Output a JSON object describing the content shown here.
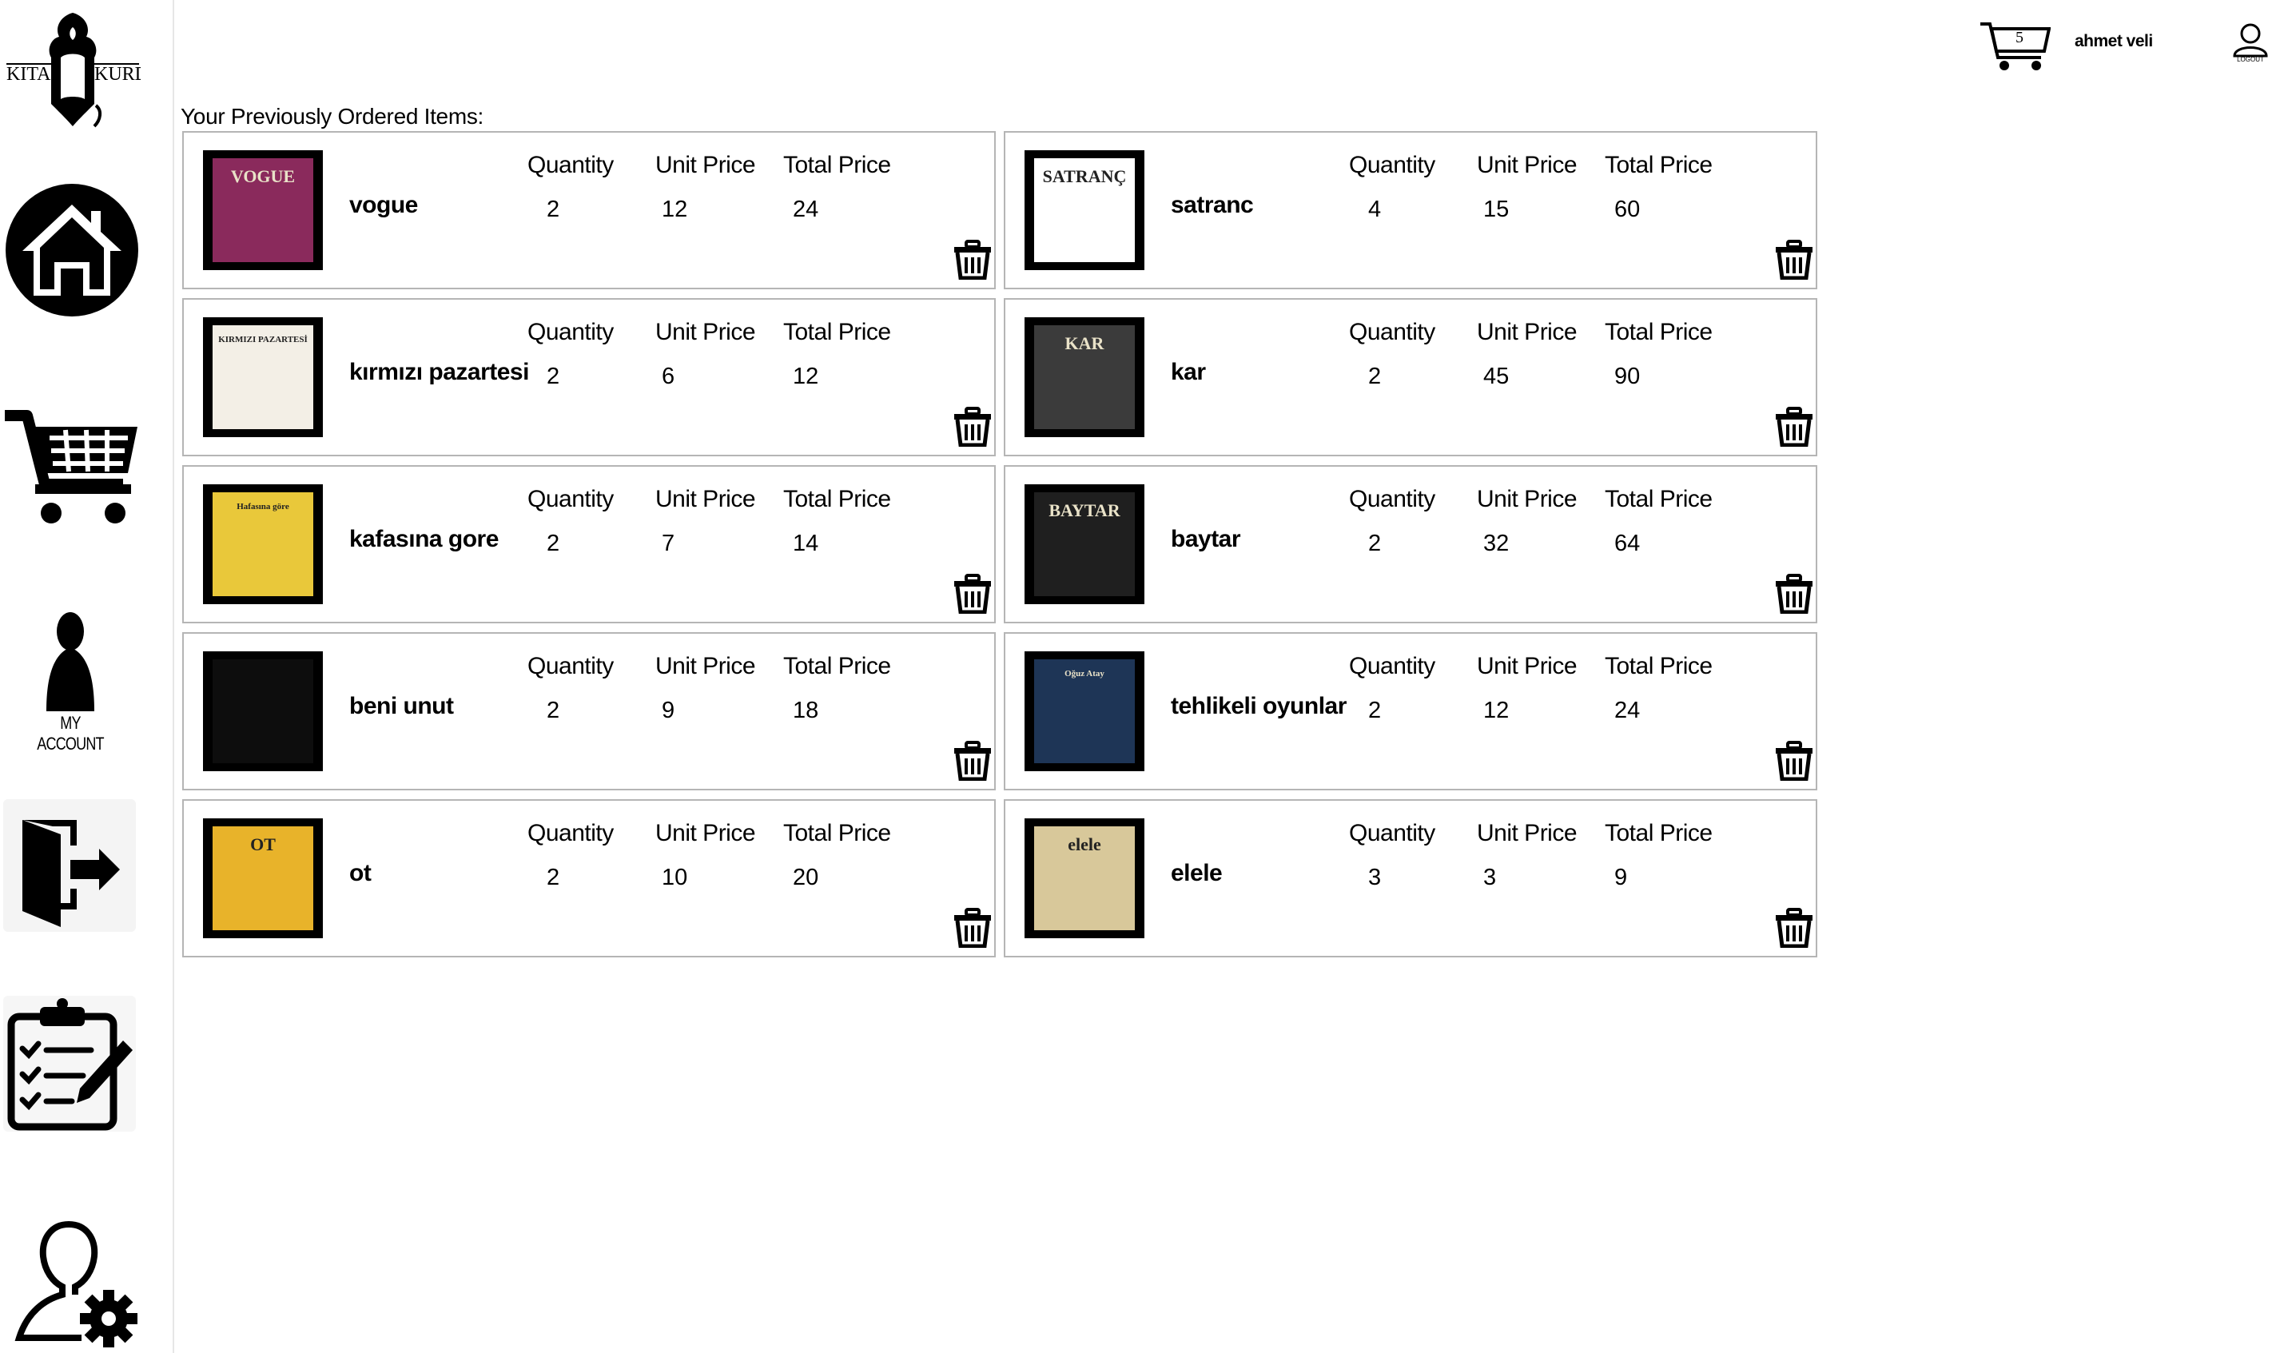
{
  "sidebar": {
    "logo_left": "KITAP",
    "logo_right": "KURDU",
    "account_label": "MY ACCOUNT"
  },
  "header": {
    "cart_count": "5",
    "username": "ahmet veli",
    "logout_label": "LOGOUT"
  },
  "main": {
    "title": "Your Previously Ordered Items:",
    "col_quantity": "Quantity",
    "col_unit_price": "Unit Price",
    "col_total_price": "Total Price"
  },
  "orders": [
    {
      "name": "vogue",
      "quantity": "2",
      "unit_price": "12",
      "total_price": "24",
      "cover_text": "VOGUE",
      "cover_bg": "#8a2a5c"
    },
    {
      "name": "satranc",
      "quantity": "4",
      "unit_price": "15",
      "total_price": "60",
      "cover_text": "SATRANÇ",
      "cover_bg": "#ffffff"
    },
    {
      "name": "kırmızı pazartesi",
      "quantity": "2",
      "unit_price": "6",
      "total_price": "12",
      "cover_text": "KIRMIZI PAZARTESİ",
      "cover_bg": "#f3efe6"
    },
    {
      "name": "kar",
      "quantity": "2",
      "unit_price": "45",
      "total_price": "90",
      "cover_text": "KAR",
      "cover_bg": "#3b3b3b"
    },
    {
      "name": "kafasına gore",
      "quantity": "2",
      "unit_price": "7",
      "total_price": "14",
      "cover_text": "Hafasına göre",
      "cover_bg": "#e9c83a"
    },
    {
      "name": "baytar",
      "quantity": "2",
      "unit_price": "32",
      "total_price": "64",
      "cover_text": "BAYTAR",
      "cover_bg": "#1f1f1f"
    },
    {
      "name": "beni unut",
      "quantity": "2",
      "unit_price": "9",
      "total_price": "18",
      "cover_text": "",
      "cover_bg": "#0d0d0d"
    },
    {
      "name": "tehlikeli oyunlar",
      "quantity": "2",
      "unit_price": "12",
      "total_price": "24",
      "cover_text": "Oğuz Atay",
      "cover_bg": "#1e3556"
    },
    {
      "name": "ot",
      "quantity": "2",
      "unit_price": "10",
      "total_price": "20",
      "cover_text": "OT",
      "cover_bg": "#e8b32a"
    },
    {
      "name": "elele",
      "quantity": "3",
      "unit_price": "3",
      "total_price": "9",
      "cover_text": "elele",
      "cover_bg": "#d8c89a"
    }
  ],
  "icons": {
    "logo": "book-worm-logo",
    "home": "home-icon",
    "cart": "shopping-cart-icon",
    "account": "user-icon",
    "logout": "logout-door-icon",
    "orders": "clipboard-checklist-icon",
    "settings": "user-settings-icon",
    "delete": "trash-icon"
  }
}
